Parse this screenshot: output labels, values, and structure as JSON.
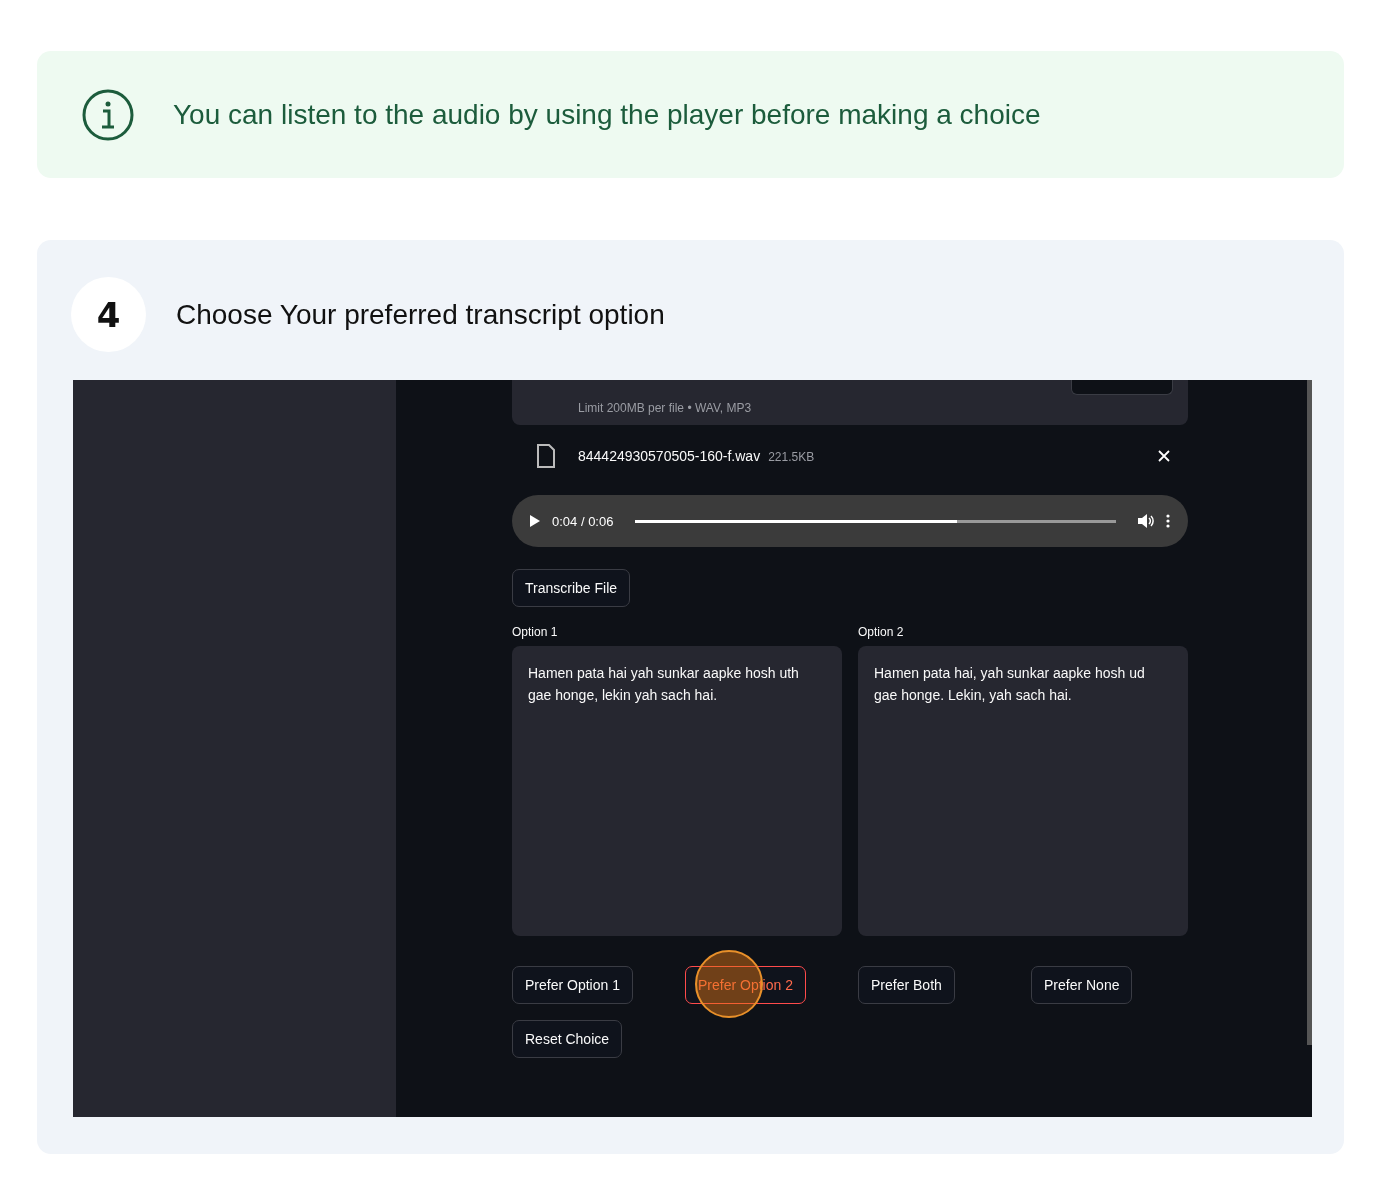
{
  "info_banner": {
    "text": "You can listen to the audio by using the player before making a choice"
  },
  "step": {
    "number": "4",
    "title": "Choose Your preferred transcript option"
  },
  "app": {
    "uploader": {
      "limit_text": "Limit 200MB per file • WAV, MP3"
    },
    "file": {
      "name": "844424930570505-160-f.wav",
      "size": "221.5KB"
    },
    "player": {
      "time": "0:04 / 0:06",
      "level": 0.67
    },
    "transcribe_button": "Transcribe File",
    "options": [
      {
        "label": "Option 1",
        "text": "Hamen pata hai yah sunkar aapke hosh uth gae honge, lekin yah sach hai."
      },
      {
        "label": "Option 2",
        "text": "Hamen pata hai, yah sunkar aapke hosh ud gae honge. Lekin, yah sach hai."
      }
    ],
    "choice_buttons": [
      {
        "label": "Prefer Option 1",
        "selected": false
      },
      {
        "label": "Prefer Option 2",
        "selected": true
      },
      {
        "label": "Prefer Both",
        "selected": false
      },
      {
        "label": "Prefer None",
        "selected": false
      },
      {
        "label": "Reset Choice",
        "selected": false
      }
    ]
  }
}
